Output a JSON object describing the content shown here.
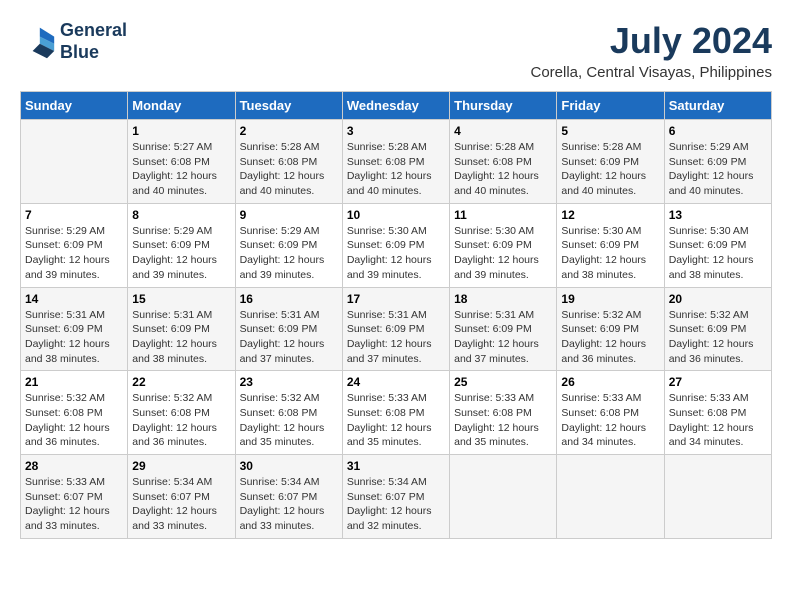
{
  "header": {
    "logo_line1": "General",
    "logo_line2": "Blue",
    "month_year": "July 2024",
    "location": "Corella, Central Visayas, Philippines"
  },
  "calendar": {
    "days_of_week": [
      "Sunday",
      "Monday",
      "Tuesday",
      "Wednesday",
      "Thursday",
      "Friday",
      "Saturday"
    ],
    "weeks": [
      [
        {
          "day": "",
          "info": ""
        },
        {
          "day": "1",
          "info": "Sunrise: 5:27 AM\nSunset: 6:08 PM\nDaylight: 12 hours\nand 40 minutes."
        },
        {
          "day": "2",
          "info": "Sunrise: 5:28 AM\nSunset: 6:08 PM\nDaylight: 12 hours\nand 40 minutes."
        },
        {
          "day": "3",
          "info": "Sunrise: 5:28 AM\nSunset: 6:08 PM\nDaylight: 12 hours\nand 40 minutes."
        },
        {
          "day": "4",
          "info": "Sunrise: 5:28 AM\nSunset: 6:08 PM\nDaylight: 12 hours\nand 40 minutes."
        },
        {
          "day": "5",
          "info": "Sunrise: 5:28 AM\nSunset: 6:09 PM\nDaylight: 12 hours\nand 40 minutes."
        },
        {
          "day": "6",
          "info": "Sunrise: 5:29 AM\nSunset: 6:09 PM\nDaylight: 12 hours\nand 40 minutes."
        }
      ],
      [
        {
          "day": "7",
          "info": "Sunrise: 5:29 AM\nSunset: 6:09 PM\nDaylight: 12 hours\nand 39 minutes."
        },
        {
          "day": "8",
          "info": "Sunrise: 5:29 AM\nSunset: 6:09 PM\nDaylight: 12 hours\nand 39 minutes."
        },
        {
          "day": "9",
          "info": "Sunrise: 5:29 AM\nSunset: 6:09 PM\nDaylight: 12 hours\nand 39 minutes."
        },
        {
          "day": "10",
          "info": "Sunrise: 5:30 AM\nSunset: 6:09 PM\nDaylight: 12 hours\nand 39 minutes."
        },
        {
          "day": "11",
          "info": "Sunrise: 5:30 AM\nSunset: 6:09 PM\nDaylight: 12 hours\nand 39 minutes."
        },
        {
          "day": "12",
          "info": "Sunrise: 5:30 AM\nSunset: 6:09 PM\nDaylight: 12 hours\nand 38 minutes."
        },
        {
          "day": "13",
          "info": "Sunrise: 5:30 AM\nSunset: 6:09 PM\nDaylight: 12 hours\nand 38 minutes."
        }
      ],
      [
        {
          "day": "14",
          "info": "Sunrise: 5:31 AM\nSunset: 6:09 PM\nDaylight: 12 hours\nand 38 minutes."
        },
        {
          "day": "15",
          "info": "Sunrise: 5:31 AM\nSunset: 6:09 PM\nDaylight: 12 hours\nand 38 minutes."
        },
        {
          "day": "16",
          "info": "Sunrise: 5:31 AM\nSunset: 6:09 PM\nDaylight: 12 hours\nand 37 minutes."
        },
        {
          "day": "17",
          "info": "Sunrise: 5:31 AM\nSunset: 6:09 PM\nDaylight: 12 hours\nand 37 minutes."
        },
        {
          "day": "18",
          "info": "Sunrise: 5:31 AM\nSunset: 6:09 PM\nDaylight: 12 hours\nand 37 minutes."
        },
        {
          "day": "19",
          "info": "Sunrise: 5:32 AM\nSunset: 6:09 PM\nDaylight: 12 hours\nand 36 minutes."
        },
        {
          "day": "20",
          "info": "Sunrise: 5:32 AM\nSunset: 6:09 PM\nDaylight: 12 hours\nand 36 minutes."
        }
      ],
      [
        {
          "day": "21",
          "info": "Sunrise: 5:32 AM\nSunset: 6:08 PM\nDaylight: 12 hours\nand 36 minutes."
        },
        {
          "day": "22",
          "info": "Sunrise: 5:32 AM\nSunset: 6:08 PM\nDaylight: 12 hours\nand 36 minutes."
        },
        {
          "day": "23",
          "info": "Sunrise: 5:32 AM\nSunset: 6:08 PM\nDaylight: 12 hours\nand 35 minutes."
        },
        {
          "day": "24",
          "info": "Sunrise: 5:33 AM\nSunset: 6:08 PM\nDaylight: 12 hours\nand 35 minutes."
        },
        {
          "day": "25",
          "info": "Sunrise: 5:33 AM\nSunset: 6:08 PM\nDaylight: 12 hours\nand 35 minutes."
        },
        {
          "day": "26",
          "info": "Sunrise: 5:33 AM\nSunset: 6:08 PM\nDaylight: 12 hours\nand 34 minutes."
        },
        {
          "day": "27",
          "info": "Sunrise: 5:33 AM\nSunset: 6:08 PM\nDaylight: 12 hours\nand 34 minutes."
        }
      ],
      [
        {
          "day": "28",
          "info": "Sunrise: 5:33 AM\nSunset: 6:07 PM\nDaylight: 12 hours\nand 33 minutes."
        },
        {
          "day": "29",
          "info": "Sunrise: 5:34 AM\nSunset: 6:07 PM\nDaylight: 12 hours\nand 33 minutes."
        },
        {
          "day": "30",
          "info": "Sunrise: 5:34 AM\nSunset: 6:07 PM\nDaylight: 12 hours\nand 33 minutes."
        },
        {
          "day": "31",
          "info": "Sunrise: 5:34 AM\nSunset: 6:07 PM\nDaylight: 12 hours\nand 32 minutes."
        },
        {
          "day": "",
          "info": ""
        },
        {
          "day": "",
          "info": ""
        },
        {
          "day": "",
          "info": ""
        }
      ]
    ]
  }
}
